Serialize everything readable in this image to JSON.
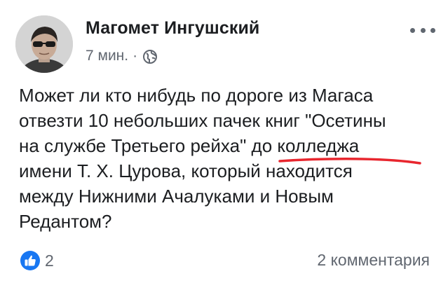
{
  "post": {
    "author": "Магомет Ингушский",
    "time": "7 мин.",
    "separator": "·",
    "privacy_icon": "globe-icon",
    "menu_icon": "more-options-icon",
    "text_lines": [
      "Может ли кто нибудь по дороге из Магаса",
      "отвезти 10 небольших пачек книг \"Осетины",
      "на службе Третьего рейха\" до колледжа",
      "имени Т. Х. Цурова, который находится",
      "между Нижними Ачалуками и Новым",
      "Редантом?"
    ],
    "annotation_color": "#e8262e"
  },
  "footer": {
    "reaction_icon": "like-icon",
    "like_count": "2",
    "comments": "2 комментария"
  },
  "colors": {
    "text": "#1c1e21",
    "secondary": "#616770",
    "like_blue": "#1877f2"
  }
}
